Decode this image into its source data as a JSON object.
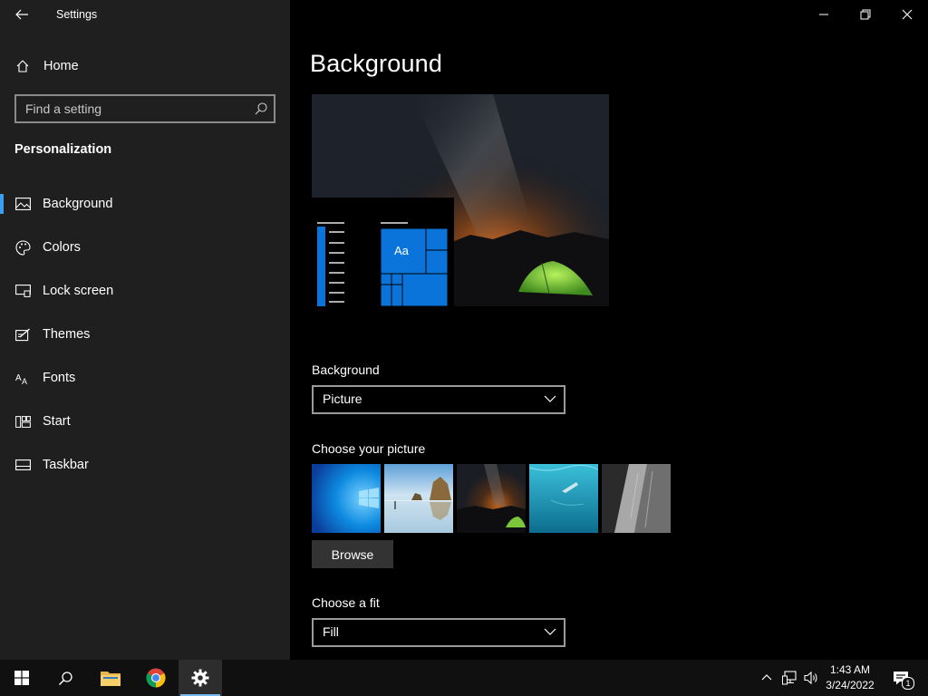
{
  "window": {
    "title": "Settings",
    "back_label": "",
    "controls": [
      "minimize",
      "restore",
      "close"
    ]
  },
  "sidebar": {
    "home": {
      "label": "Home",
      "icon": "home-icon"
    },
    "search": {
      "placeholder": "Find a setting",
      "value": ""
    },
    "section": "Personalization",
    "items": [
      {
        "label": "Background",
        "icon": "picture-icon",
        "active": true
      },
      {
        "label": "Colors",
        "icon": "palette-icon",
        "active": false
      },
      {
        "label": "Lock screen",
        "icon": "lock-screen-icon",
        "active": false
      },
      {
        "label": "Themes",
        "icon": "themes-icon",
        "active": false
      },
      {
        "label": "Fonts",
        "icon": "fonts-icon",
        "active": false
      },
      {
        "label": "Start",
        "icon": "start-icon",
        "active": false
      },
      {
        "label": "Taskbar",
        "icon": "taskbar-icon",
        "active": false
      }
    ],
    "accent_color": "#3a9ff1"
  },
  "main": {
    "title": "Background",
    "preview": {
      "tile_label": "Aa"
    },
    "background_label": "Background",
    "background_value": "Picture",
    "choose_picture_label": "Choose your picture",
    "thumbnails": [
      "windows-blue",
      "beach-rocks",
      "night-sky-tent",
      "underwater-swimmer",
      "rock-cliff"
    ],
    "browse_label": "Browse",
    "fit_label": "Choose a fit",
    "fit_value": "Fill",
    "tile_color": "#0a74da"
  },
  "taskbar": {
    "apps": [
      "start-icon",
      "search-icon",
      "file-explorer-icon",
      "chrome-icon",
      "settings-icon"
    ],
    "active_app": "settings-icon",
    "time": "1:43 AM",
    "date": "3/24/2022",
    "notification_count": "1"
  }
}
